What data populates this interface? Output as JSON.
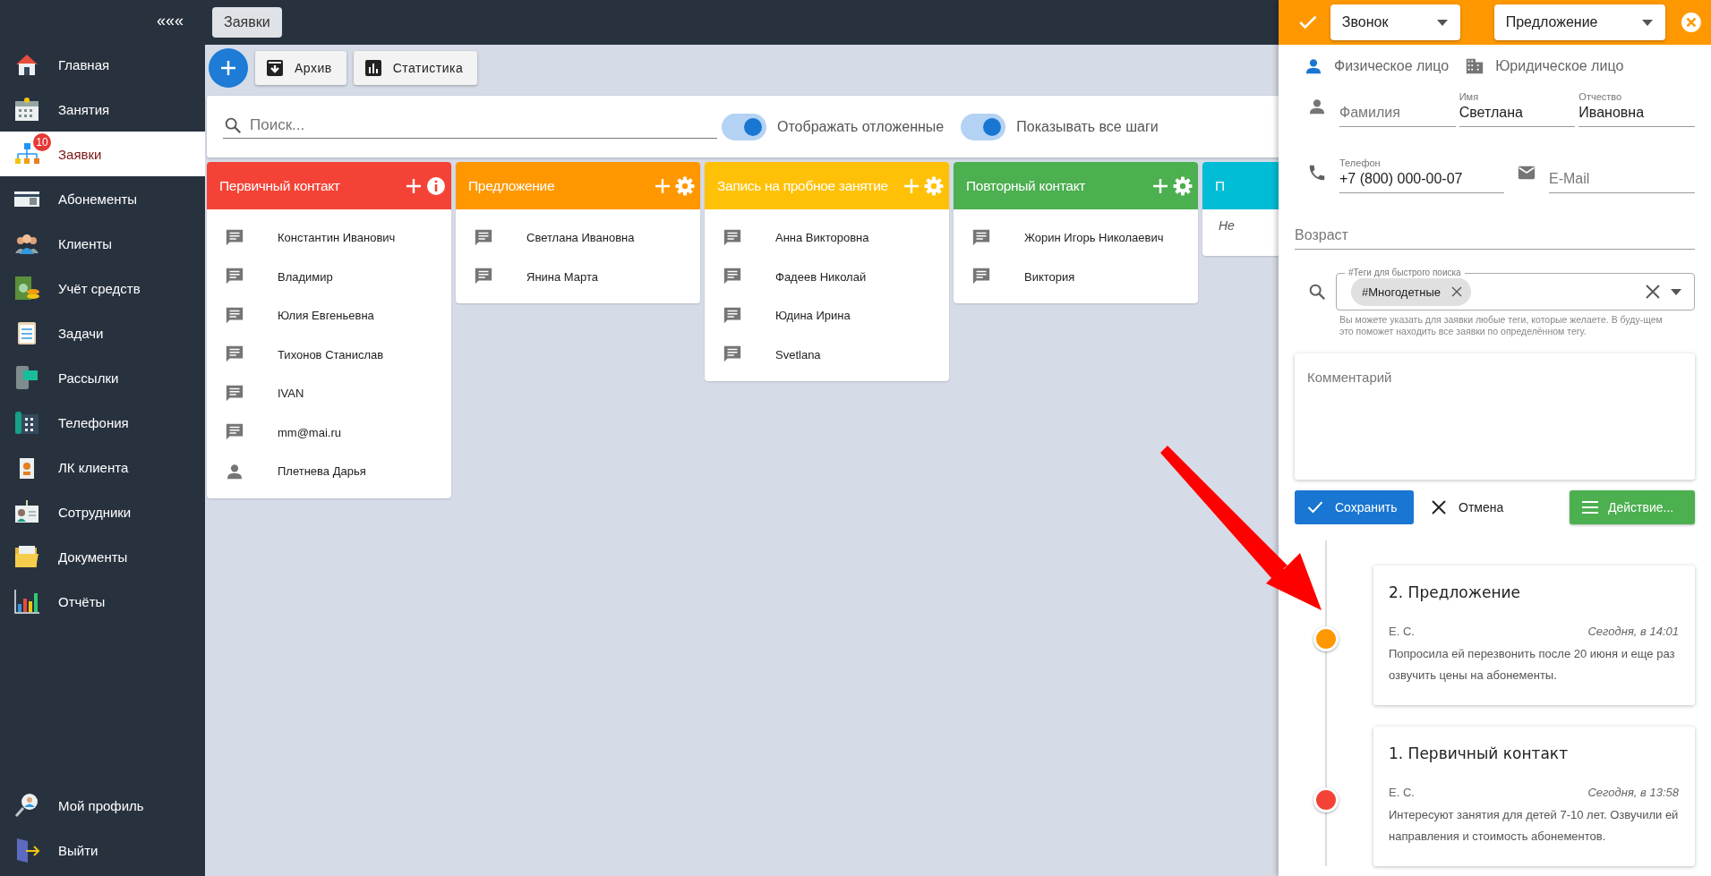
{
  "sidebar": {
    "collapse_label": "«««",
    "items": [
      {
        "label": "Главная",
        "selected": false
      },
      {
        "label": "Занятия",
        "selected": false
      },
      {
        "label": "Заявки",
        "selected": true,
        "badge": "10"
      },
      {
        "label": "Абонементы",
        "selected": false
      },
      {
        "label": "Клиенты",
        "selected": false
      },
      {
        "label": "Учёт средств",
        "selected": false
      },
      {
        "label": "Задачи",
        "selected": false
      },
      {
        "label": "Рассылки",
        "selected": false
      },
      {
        "label": "Телефония",
        "selected": false
      },
      {
        "label": "ЛК клиента",
        "selected": false
      },
      {
        "label": "Сотрудники",
        "selected": false
      },
      {
        "label": "Документы",
        "selected": false
      },
      {
        "label": "Отчёты",
        "selected": false
      }
    ],
    "bottom_items": [
      {
        "label": "Мой профиль"
      },
      {
        "label": "Выйти"
      }
    ]
  },
  "top_tabs": [
    {
      "label": "Заявки",
      "selected": true
    }
  ],
  "toolbar": {
    "buttons": [
      {
        "label": "Архив",
        "kind": "archive"
      },
      {
        "label": "Статистика",
        "kind": "stats"
      }
    ]
  },
  "filters": {
    "search": {
      "placeholder": "Поиск..."
    },
    "toggles": [
      {
        "label": "Отображать отложенные",
        "on": true
      },
      {
        "label": "Показывать все шаги",
        "on": true
      }
    ]
  },
  "columns": [
    {
      "title": "Первичный контакт",
      "color": "#f44336",
      "kind": "info",
      "items": [
        {
          "name": "Константин Иванович",
          "kind": "message"
        },
        {
          "name": "Владимир",
          "kind": "message"
        },
        {
          "name": "Юлия Евгеньевна",
          "kind": "message"
        },
        {
          "name": "Тихонов Станислав",
          "kind": "message"
        },
        {
          "name": "IVAN",
          "kind": "message"
        },
        {
          "name": "mm@mai.ru",
          "kind": "message"
        },
        {
          "name": "Плетнева Дарья",
          "kind": "person"
        }
      ]
    },
    {
      "title": "Предложение",
      "color": "#ff9800",
      "kind": "settings",
      "items": [
        {
          "name": "Светлана Ивановна",
          "kind": "message"
        },
        {
          "name": "Янина Марта",
          "kind": "message"
        }
      ]
    },
    {
      "title": "Запись на пробное занятие",
      "color": "#ffc107",
      "kind": "settings",
      "items": [
        {
          "name": "Анна Викторовна",
          "kind": "message"
        },
        {
          "name": "Фадеев Николай",
          "kind": "message"
        },
        {
          "name": "Юдина Ирина",
          "kind": "message"
        },
        {
          "name": "Svetlana",
          "kind": "message"
        }
      ]
    },
    {
      "title": "Повторный контакт",
      "color": "#4caf50",
      "kind": "settings",
      "items": [
        {
          "name": "Жорин Игорь Николаевич",
          "kind": "message"
        },
        {
          "name": "Виктория",
          "kind": "message"
        }
      ]
    },
    {
      "title": "П",
      "color": "#00bcd4",
      "kind": "none",
      "note": "Не"
    }
  ],
  "panel": {
    "header": {
      "type_select": "Звонок",
      "stage_select": "Предложение"
    },
    "person_types": [
      {
        "label": "Физическое лицо",
        "selected": true
      },
      {
        "label": "Юридическое лицо",
        "selected": false
      }
    ],
    "surname": {
      "placeholder": "Фамилия"
    },
    "name": {
      "label": "Имя",
      "value": "Светлана"
    },
    "patronymic": {
      "label": "Отчество",
      "value": "Ивановна"
    },
    "phone": {
      "label": "Телефон",
      "value": "+7 (800) 000-00-07"
    },
    "email": {
      "placeholder": "E-Mail"
    },
    "age": {
      "placeholder": "Возраст"
    },
    "tags": {
      "label": "#Теги для быстрого поиска",
      "chips": [
        "#Многодетные"
      ],
      "hint": "Вы можете указать для заявки любые теги, которые желаете. В буду-щем это поможет находить все заявки по определённом тегу."
    },
    "comment": {
      "placeholder": "Комментарий"
    },
    "buttons": {
      "save": "Сохранить",
      "cancel": "Отмена",
      "actions": "Действие..."
    },
    "timeline": [
      {
        "title": "2. Предложение",
        "author": "Е. С.",
        "time": "Сегодня, в 14:01",
        "text": "Попросила ей перезвонить после 20 июня и еще раз озвучить цены на абонементы.",
        "color": "#ff9800"
      },
      {
        "title": "1. Первичный контакт",
        "author": "Е. С.",
        "time": "Сегодня, в 13:58",
        "text": "Интересуют занятия для детей 7-10 лет. Озвучили ей направления и стоимость абонементов.",
        "color": "#f44336"
      }
    ]
  }
}
